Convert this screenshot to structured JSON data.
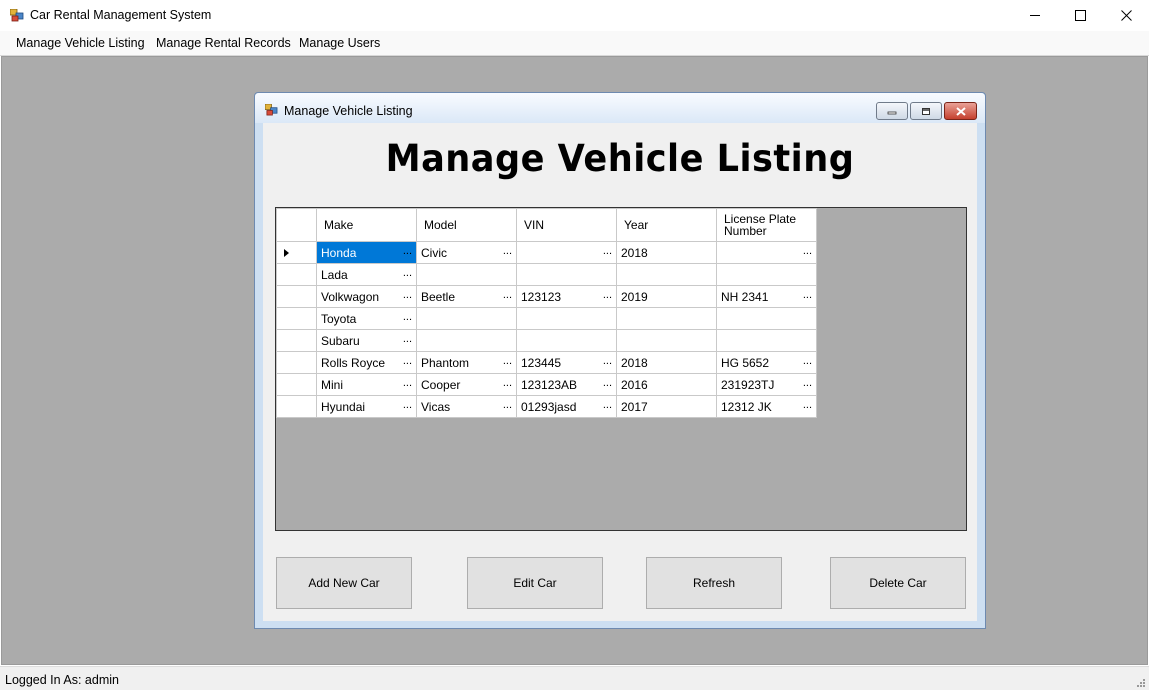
{
  "window": {
    "title": "Car Rental Management System"
  },
  "menu": {
    "items": [
      "Manage Vehicle Listing",
      "Manage Rental Records",
      "Manage Users"
    ]
  },
  "child_window": {
    "title": "Manage Vehicle Listing",
    "heading": "Manage Vehicle Listing"
  },
  "grid": {
    "columns": [
      "Make",
      "Model",
      "VIN",
      "Year",
      "License Plate\nNumber"
    ],
    "rows": [
      [
        "Honda",
        "Civic",
        "",
        "2018",
        ""
      ],
      [
        "Lada",
        "",
        "",
        "",
        ""
      ],
      [
        "Volkwagon",
        "Beetle",
        "123123",
        "2019",
        "NH 2341"
      ],
      [
        "Toyota",
        "",
        "",
        "",
        ""
      ],
      [
        "Subaru",
        "",
        "",
        "",
        ""
      ],
      [
        "Rolls Royce",
        "Phantom",
        "123445",
        "2018",
        "HG 5652"
      ],
      [
        "Mini",
        "Cooper",
        "123123AB",
        "2016",
        "231923TJ"
      ],
      [
        "Hyundai",
        "Vicas",
        "01293jasd",
        "2017",
        "12312 JK"
      ]
    ],
    "ellipsis": "...",
    "selected_row": 0
  },
  "buttons": {
    "add": "Add New Car",
    "edit": "Edit Car",
    "refresh": "Refresh",
    "delete": "Delete Car"
  },
  "status": {
    "text": "Logged In As: admin"
  }
}
